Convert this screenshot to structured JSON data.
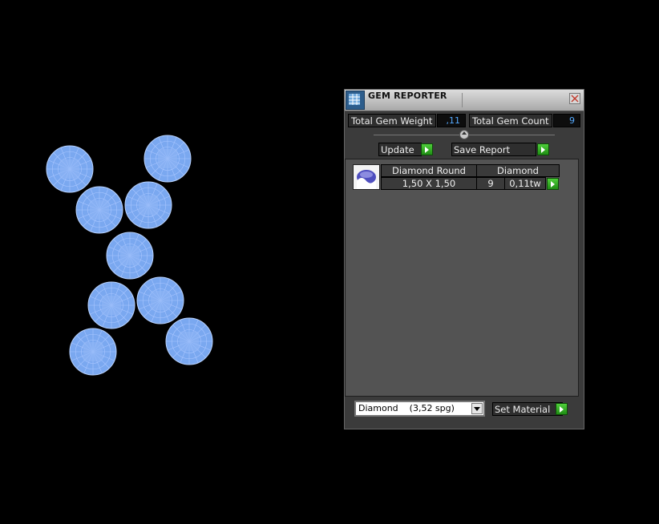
{
  "viewport": {
    "gems": [
      {
        "shape": "round",
        "color": "#7aa8f0"
      },
      {
        "shape": "round",
        "color": "#7aa8f0"
      },
      {
        "shape": "round",
        "color": "#7aa8f0"
      },
      {
        "shape": "round",
        "color": "#7aa8f0"
      },
      {
        "shape": "round",
        "color": "#7aa8f0"
      },
      {
        "shape": "round",
        "color": "#7aa8f0"
      },
      {
        "shape": "round",
        "color": "#7aa8f0"
      },
      {
        "shape": "round",
        "color": "#7aa8f0"
      },
      {
        "shape": "round",
        "color": "#7aa8f0"
      }
    ]
  },
  "panel": {
    "title": "GEM REPORTER",
    "title_icon": "report-grid-icon",
    "close_icon": "close-icon",
    "total_weight_label": "Total Gem Weight",
    "total_weight_value": ",11",
    "total_count_label": "Total Gem Count",
    "total_count_value": "9",
    "update_label": "Update",
    "save_report_label": "Save Report",
    "report_rows": [
      {
        "name": "Diamond Round",
        "material": "Diamond",
        "size": "1,50 X 1,50",
        "count": "9",
        "weight": "0,11tw"
      }
    ],
    "material_select_value": "Diamond    (3,52 spg)",
    "set_material_label": "Set Material",
    "accent_green": "#2faa1e",
    "value_color": "#55aaff"
  }
}
